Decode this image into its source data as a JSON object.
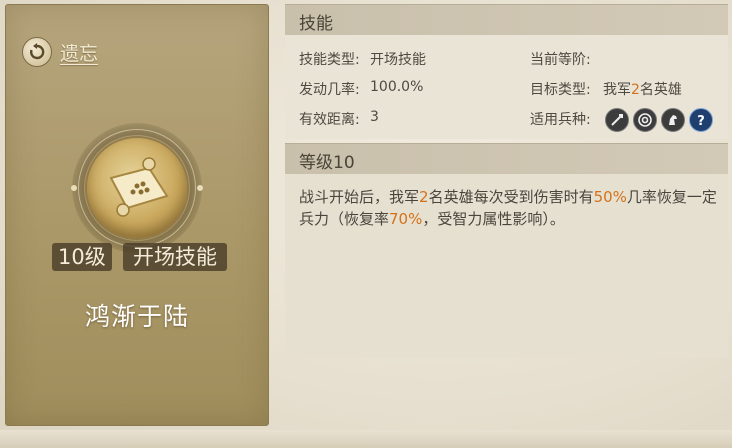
{
  "left_panel": {
    "forget_label": "遗忘",
    "level_badge": "10级",
    "type_badge": "开场技能",
    "skill_name": "鸿渐于陆"
  },
  "skill_section": {
    "header": "技能",
    "skill_type_label": "技能类型:",
    "skill_type_value": "开场技能",
    "current_rank_label": "当前等阶:",
    "current_rank_value": "",
    "trigger_rate_label": "发动几率:",
    "trigger_rate_value": "100.0%",
    "target_type_label": "目标类型:",
    "target_type_prefix": "我军",
    "target_type_count": "2",
    "target_type_suffix": "名英雄",
    "range_label": "有效距离:",
    "range_value": "3",
    "unit_types_label": "适用兵种:",
    "unit_icons": [
      "sword-icon",
      "target-icon",
      "horse-icon",
      "question-icon"
    ]
  },
  "level_section": {
    "header": "等级10",
    "desc_part1": "战斗开始后，我军",
    "desc_hl1": "2",
    "desc_part2": "名英雄每次受到伤害时有",
    "desc_hl2": "50%",
    "desc_part3": "几率恢复一定兵力（恢复率",
    "desc_hl3": "70%",
    "desc_part4": "，受智力属性影响）。"
  },
  "colors": {
    "highlight": "#d4721c",
    "panel": "#aa9868"
  }
}
